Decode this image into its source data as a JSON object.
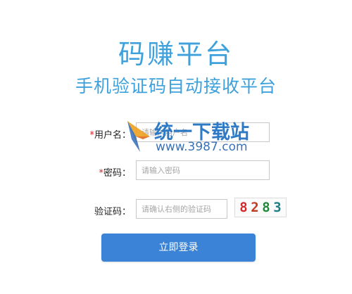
{
  "header": {
    "title": "码赚平台",
    "subtitle": "手机验证码自动接收平台"
  },
  "form": {
    "username": {
      "required_mark": "*",
      "label": "用户名：",
      "placeholder": "请输入用户名"
    },
    "password": {
      "required_mark": "*",
      "label": "密码：",
      "placeholder": "请输入密码"
    },
    "captcha": {
      "label": "验证码：",
      "placeholder": "请确认右侧的验证码",
      "digits": [
        {
          "char": "8",
          "color": "#d12b2b"
        },
        {
          "char": "2",
          "color": "#c43a1e"
        },
        {
          "char": "8",
          "color": "#1f8a3a"
        },
        {
          "char": "3",
          "color": "#1e7e87"
        }
      ]
    },
    "login_button": "立即登录"
  },
  "watermark": {
    "brand": "统一下载站",
    "url": "www.3987.com"
  }
}
